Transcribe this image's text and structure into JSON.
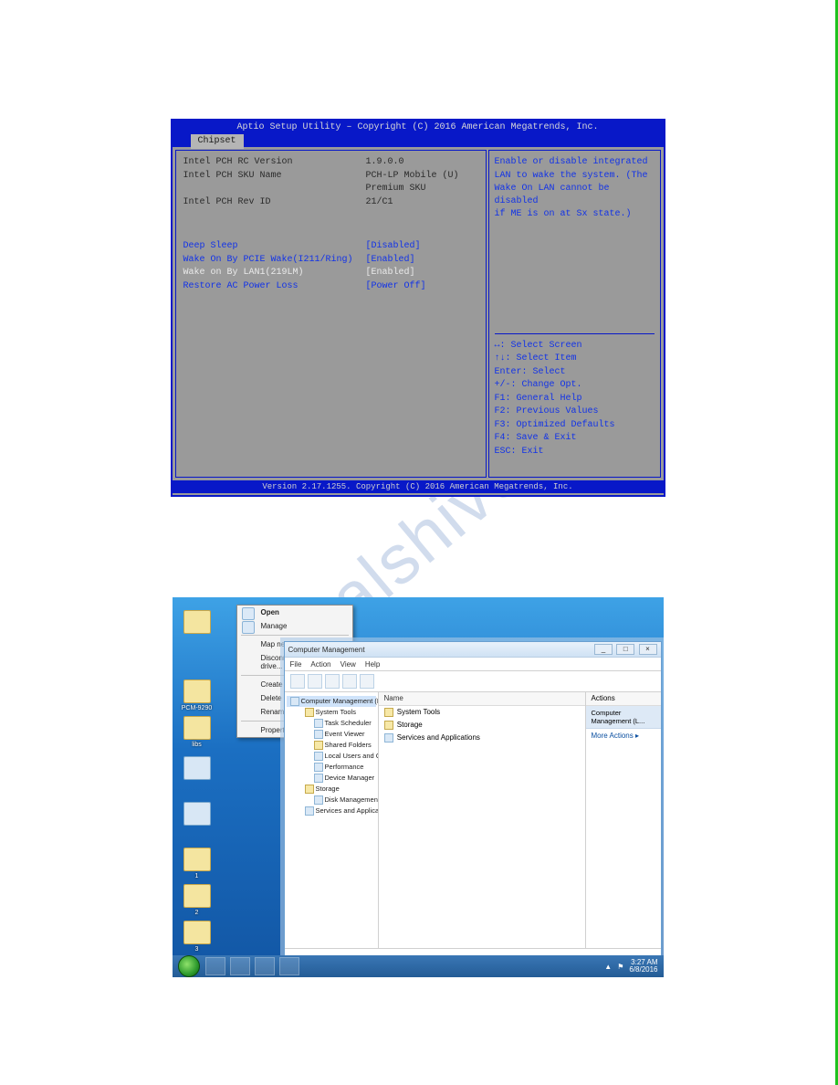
{
  "watermark": "manualshive.com",
  "bios": {
    "title": "Aptio Setup Utility – Copyright (C) 2016 American Megatrends, Inc.",
    "tab": "Chipset",
    "footer": "Version 2.17.1255. Copyright (C) 2016 American Megatrends, Inc.",
    "info": [
      {
        "label": "Intel PCH RC Version",
        "value": "1.9.0.0"
      },
      {
        "label": "Intel PCH SKU Name",
        "value": "PCH-LP Mobile (U)"
      },
      {
        "label": "",
        "value": "Premium SKU"
      },
      {
        "label": "Intel PCH Rev ID",
        "value": "21/C1"
      }
    ],
    "options": [
      {
        "label": "Deep Sleep",
        "value": "[Disabled]",
        "current": false
      },
      {
        "label": "Wake On By PCIE Wake(I211/Ring)",
        "value": "[Enabled]",
        "current": false
      },
      {
        "label": "Wake on By LAN1(219LM)",
        "value": "[Enabled]",
        "current": true
      },
      {
        "label": "Restore AC Power Loss",
        "value": "[Power Off]",
        "current": false
      }
    ],
    "help_desc": [
      "Enable or disable integrated",
      "LAN to wake the system. (The",
      "Wake On LAN cannot be disabled",
      "if ME is on at Sx state.)"
    ],
    "keys": [
      "↔: Select Screen",
      "↑↓: Select Item",
      "Enter: Select",
      "+/-: Change Opt.",
      "F1: General Help",
      "F2: Previous Values",
      "F3: Optimized Defaults",
      "F4: Save & Exit",
      "ESC: Exit"
    ]
  },
  "win": {
    "desktop_icons": [
      "",
      "PCM-9290",
      "libs",
      "",
      "",
      "1",
      "2",
      "3"
    ],
    "context_menu": {
      "open": "Open",
      "manage": "Manage",
      "map": "Map network drive...",
      "disconnect": "Disconnect network drive...",
      "shortcut": "Create shortcut",
      "delete": "Delete",
      "rename": "Rename",
      "properties": "Properties"
    },
    "mmc": {
      "title": "Computer Management",
      "menus": [
        "File",
        "Action",
        "View",
        "Help"
      ],
      "tree": {
        "root": "Computer Management (Local",
        "system_tools": "System Tools",
        "task": "Task Scheduler",
        "event": "Event Viewer",
        "shared": "Shared Folders",
        "users": "Local Users and Groups",
        "perf": "Performance",
        "devmgr": "Device Manager",
        "storage": "Storage",
        "disk": "Disk Management",
        "services": "Services and Applications"
      },
      "mid_header": "Name",
      "mid_rows": [
        "System Tools",
        "Storage",
        "Services and Applications"
      ],
      "actions_header": "Actions",
      "actions_group": "Computer Management (L...",
      "actions_more": "More Actions",
      "winbtn_min": "_",
      "winbtn_max": "□",
      "winbtn_close": "×"
    },
    "tray": {
      "time": "3:27 AM",
      "date": "6/8/2016",
      "up": "▲",
      "flag": "⚑"
    }
  }
}
